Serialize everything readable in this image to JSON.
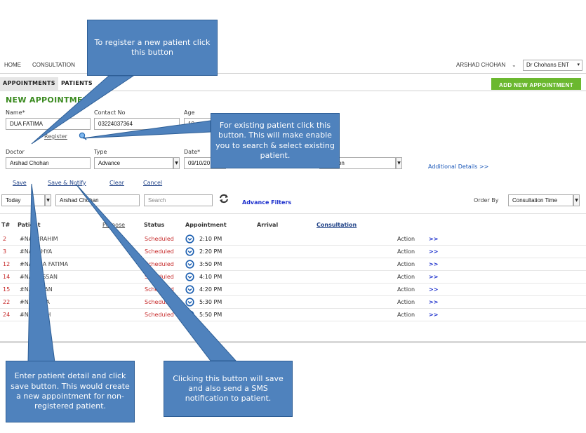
{
  "nav": {
    "items": [
      "HOME",
      "CONSULTATION"
    ],
    "user_name": "ARSHAD CHOHAN",
    "clinic": "Dr Chohans ENT"
  },
  "tabs": [
    "APPOINTMENTS",
    "PATIENTS"
  ],
  "add_button": "ADD NEW APPOINTMENT",
  "form": {
    "title": "NEW APPOINTMENT",
    "name_label": "Name*",
    "name_value": "DUA FATIMA",
    "contact_label": "Contact No",
    "contact_value": "03224037364",
    "age_label": "Age",
    "age_value": "10",
    "register_link": "Register",
    "doctor_label": "Doctor",
    "doctor_value": "Arshad Chohan",
    "type_label": "Type",
    "type_value": "Advance",
    "date_label": "Date*",
    "date_value": "09/10/20",
    "consult_value": "sultation",
    "additional_details": "Additional Details >>",
    "save": "Save",
    "save_notify": "Save & Notify",
    "clear": "Clear",
    "cancel": "Cancel"
  },
  "filters": {
    "period": "Today",
    "doctor": "Arshad Chohan",
    "search_placeholder": "Search",
    "advance_filters": "Advance Filters",
    "order_by_label": "Order By",
    "order_by_value": "Consultation Time"
  },
  "table": {
    "headers": [
      "T#",
      "Patient",
      "Purpose",
      "Status",
      "Appointment",
      "Arrival",
      "Consultation"
    ],
    "rows": [
      {
        "num": "2",
        "patient": "#NA IBRAHIM",
        "status": "Scheduled",
        "time": "2:10 PM",
        "action": "Action",
        "go": ">>"
      },
      {
        "num": "3",
        "patient": "#NA YAHYA",
        "status": "Scheduled",
        "time": "2:20 PM",
        "action": "Action",
        "go": ">>"
      },
      {
        "num": "12",
        "patient": "#NA DUA FATIMA",
        "status": "Scheduled",
        "time": "3:50 PM",
        "action": "Action",
        "go": ">>"
      },
      {
        "num": "14",
        "patient": "#NA HASSAN",
        "status": "Scheduled",
        "time": "4:10 PM",
        "action": "Action",
        "go": ">>"
      },
      {
        "num": "15",
        "patient": "#NA ZAYAN",
        "status": "Scheduled",
        "time": "4:20 PM",
        "action": "Action",
        "go": ">>"
      },
      {
        "num": "22",
        "patient": "#NA ANSA",
        "status": "Scheduled",
        "time": "5:30 PM",
        "action": "Action",
        "go": ">>"
      },
      {
        "num": "24",
        "patient": "#NA IFRAH",
        "status": "Scheduled",
        "time": "5:50 PM",
        "action": "Action",
        "go": ">>"
      }
    ]
  },
  "callouts": {
    "register": "To register a new patient click this button",
    "search_existing": "For existing patient click this button. This will make enable you to search & select existing patient.",
    "save": "Enter patient detail and click save button. This would create a new appointment for non-registered patient.",
    "save_notify": "Clicking this button will save and also send a SMS notification to patient."
  },
  "colors": {
    "accent_green": "#6bb82f",
    "title_green": "#3a8a1f",
    "status_red": "#c62828",
    "link_blue": "#1a2ecc",
    "callout_blue": "#4f82bd"
  }
}
